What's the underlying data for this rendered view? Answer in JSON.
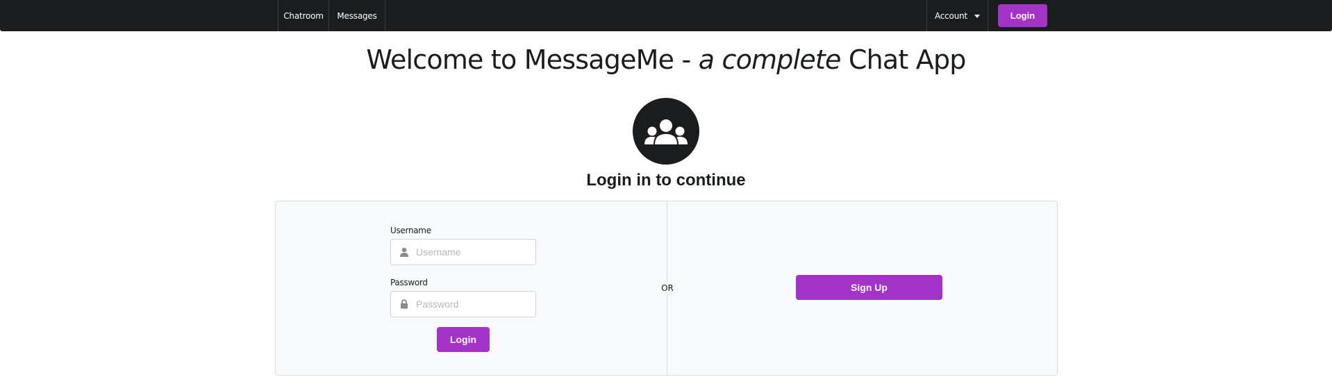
{
  "navbar": {
    "items": [
      {
        "label": "Chatroom"
      },
      {
        "label": "Messages"
      }
    ],
    "account_label": "Account",
    "login_label": "Login"
  },
  "page": {
    "title_prefix": "Welcome to MessageMe - ",
    "title_emphasis": "a complete",
    "title_suffix": " Chat App",
    "subtitle": "Login in to continue"
  },
  "login_form": {
    "username_label": "Username",
    "username_placeholder": "Username",
    "username_value": "",
    "password_label": "Password",
    "password_placeholder": "Password",
    "password_value": "",
    "submit_label": "Login"
  },
  "divider_text": "OR",
  "signup": {
    "button_label": "Sign Up"
  },
  "icons": {
    "group": "users-icon",
    "username": "user-icon",
    "password": "lock-icon",
    "account_caret": "caret-down-icon"
  },
  "colors": {
    "navbar_bg": "#1b1c1d",
    "accent_purple": "#a333c8",
    "segment_bg": "#f8f9fa"
  }
}
